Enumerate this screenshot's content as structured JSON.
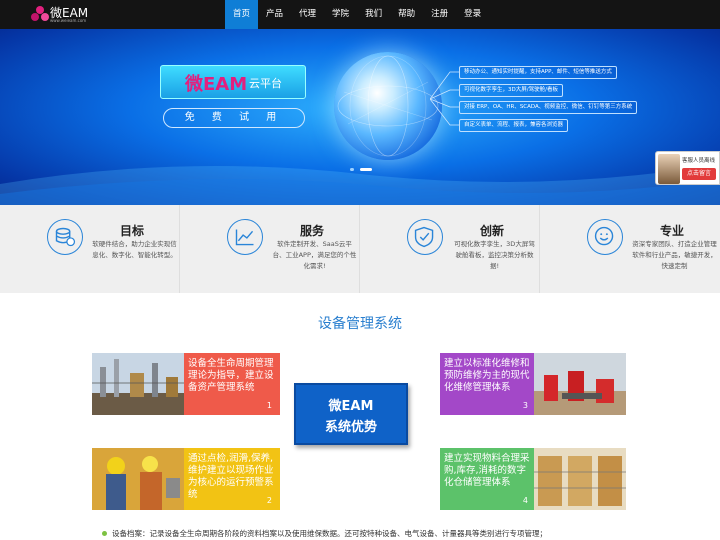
{
  "logo": {
    "brand": "微EAM",
    "url_text": "www.weieam.com"
  },
  "nav": {
    "items": [
      "首页",
      "产品",
      "代理",
      "学院",
      "我们",
      "帮助",
      "注册",
      "登录"
    ],
    "active_index": 0
  },
  "banner": {
    "brand_name": "微EAM",
    "brand_tag": "云平台",
    "trial_label": "免 费 试 用",
    "features": [
      "移动办公、通知实时提醒，支持APP、邮件、短信等推送方式",
      "可视化数字孪生，3D大屏/驾驶舱/看板",
      "对接 ERP、OA、HR、SCADA、视频监控、微信、钉钉等第三方系统",
      "自定义表单、流程、报表，兼容各浏览器"
    ],
    "chat": {
      "text": "客服人员离线",
      "button": "点击留言"
    }
  },
  "cards": [
    {
      "title": "目标",
      "desc": "软硬件结合，助力企业实现信息化、数字化、智能化转型。",
      "icon": "database-icon"
    },
    {
      "title": "服务",
      "desc": "软件定制开发、SaaS云平台、工业APP，满足您的个性化需求!",
      "icon": "chart-icon"
    },
    {
      "title": "创新",
      "desc": "可视化数字孪生，3D大屏驾驶舱看板，监控决策分析数据!",
      "icon": "shield-icon"
    },
    {
      "title": "专业",
      "desc": "资深专家团队、打造企业管理软件和行业产品，敏捷开发，快速定制",
      "icon": "smile-icon"
    }
  ],
  "section": {
    "title": "设备管理系统",
    "center_line1": "微EAM",
    "center_line2": "系统优势"
  },
  "blocks": [
    {
      "text": "设备全生命周期管理理论为指导，建立设备资产管理系统",
      "num": "1",
      "color": "#ef5a4a",
      "photo": "refinery-photo"
    },
    {
      "text": "通过点检,润滑,保养,维护建立以现场作业为核心的运行预警系统",
      "num": "2",
      "color": "#f2c314",
      "photo": "workers-photo"
    },
    {
      "text": "建立以标准化维修和预防维修为主的现代化维修管理体系",
      "num": "3",
      "color": "#a348c8",
      "photo": "oilfield-photo"
    },
    {
      "text": "建立实现物料合理采购,库存,消耗的数字化仓储管理体系",
      "num": "4",
      "color": "#5cc26a",
      "photo": "warehouse-photo"
    }
  ],
  "bullet": "设备档案：记录设备全生命周期各阶段的资料档案以及使用维保数据。还可按特种设备、电气设备、计量器具等类别进行专项管理；"
}
